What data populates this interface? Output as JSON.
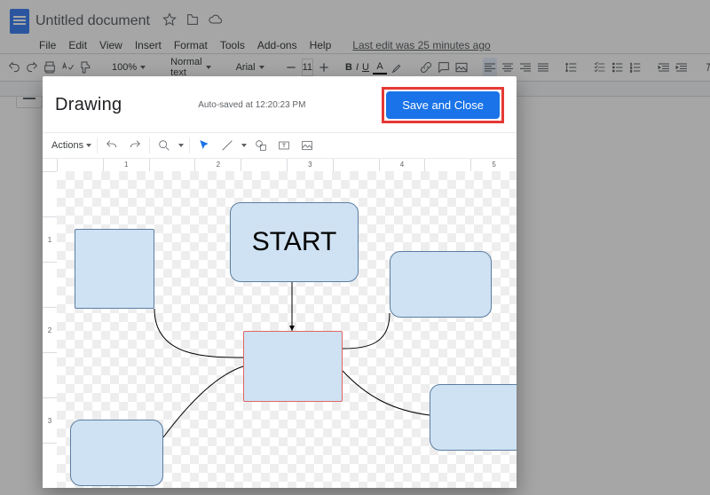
{
  "docs": {
    "title": "Untitled document",
    "menus": [
      "File",
      "Edit",
      "View",
      "Insert",
      "Format",
      "Tools",
      "Add-ons",
      "Help"
    ],
    "last_edit": "Last edit was 25 minutes ago",
    "toolbar": {
      "zoom": "100%",
      "style": "Normal text",
      "font": "Arial",
      "font_size": "11"
    }
  },
  "drawing": {
    "title": "Drawing",
    "autosave": "Auto-saved at 12:20:23 PM",
    "save_close": "Save and Close",
    "actions_label": "Actions",
    "hruler": [
      "",
      "1",
      "",
      "2",
      "",
      "3",
      "",
      "4",
      "",
      "5"
    ],
    "vruler": [
      "",
      "1",
      "",
      "2",
      "",
      "3",
      ""
    ],
    "shapes": {
      "start_label": "START"
    }
  }
}
